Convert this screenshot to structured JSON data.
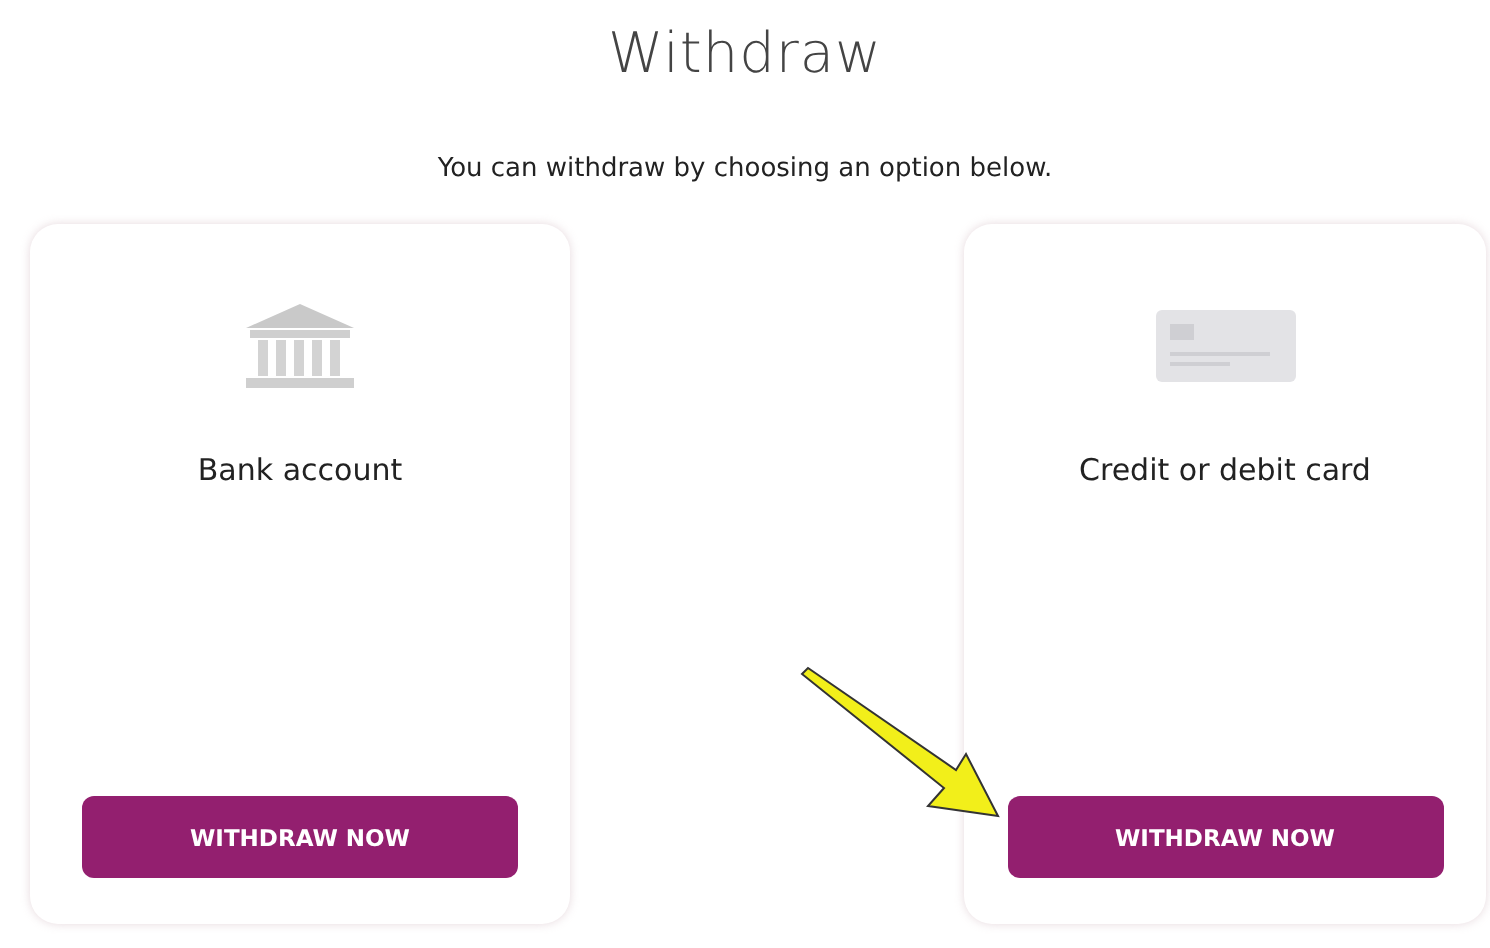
{
  "title": "Withdraw",
  "subtitle": "You can withdraw by choosing an option below.",
  "options": [
    {
      "kind": "bank",
      "label": "Bank account",
      "button": "WITHDRAW NOW"
    },
    {
      "kind": "card",
      "label": "Credit or debit card",
      "button": "WITHDRAW NOW"
    }
  ]
}
